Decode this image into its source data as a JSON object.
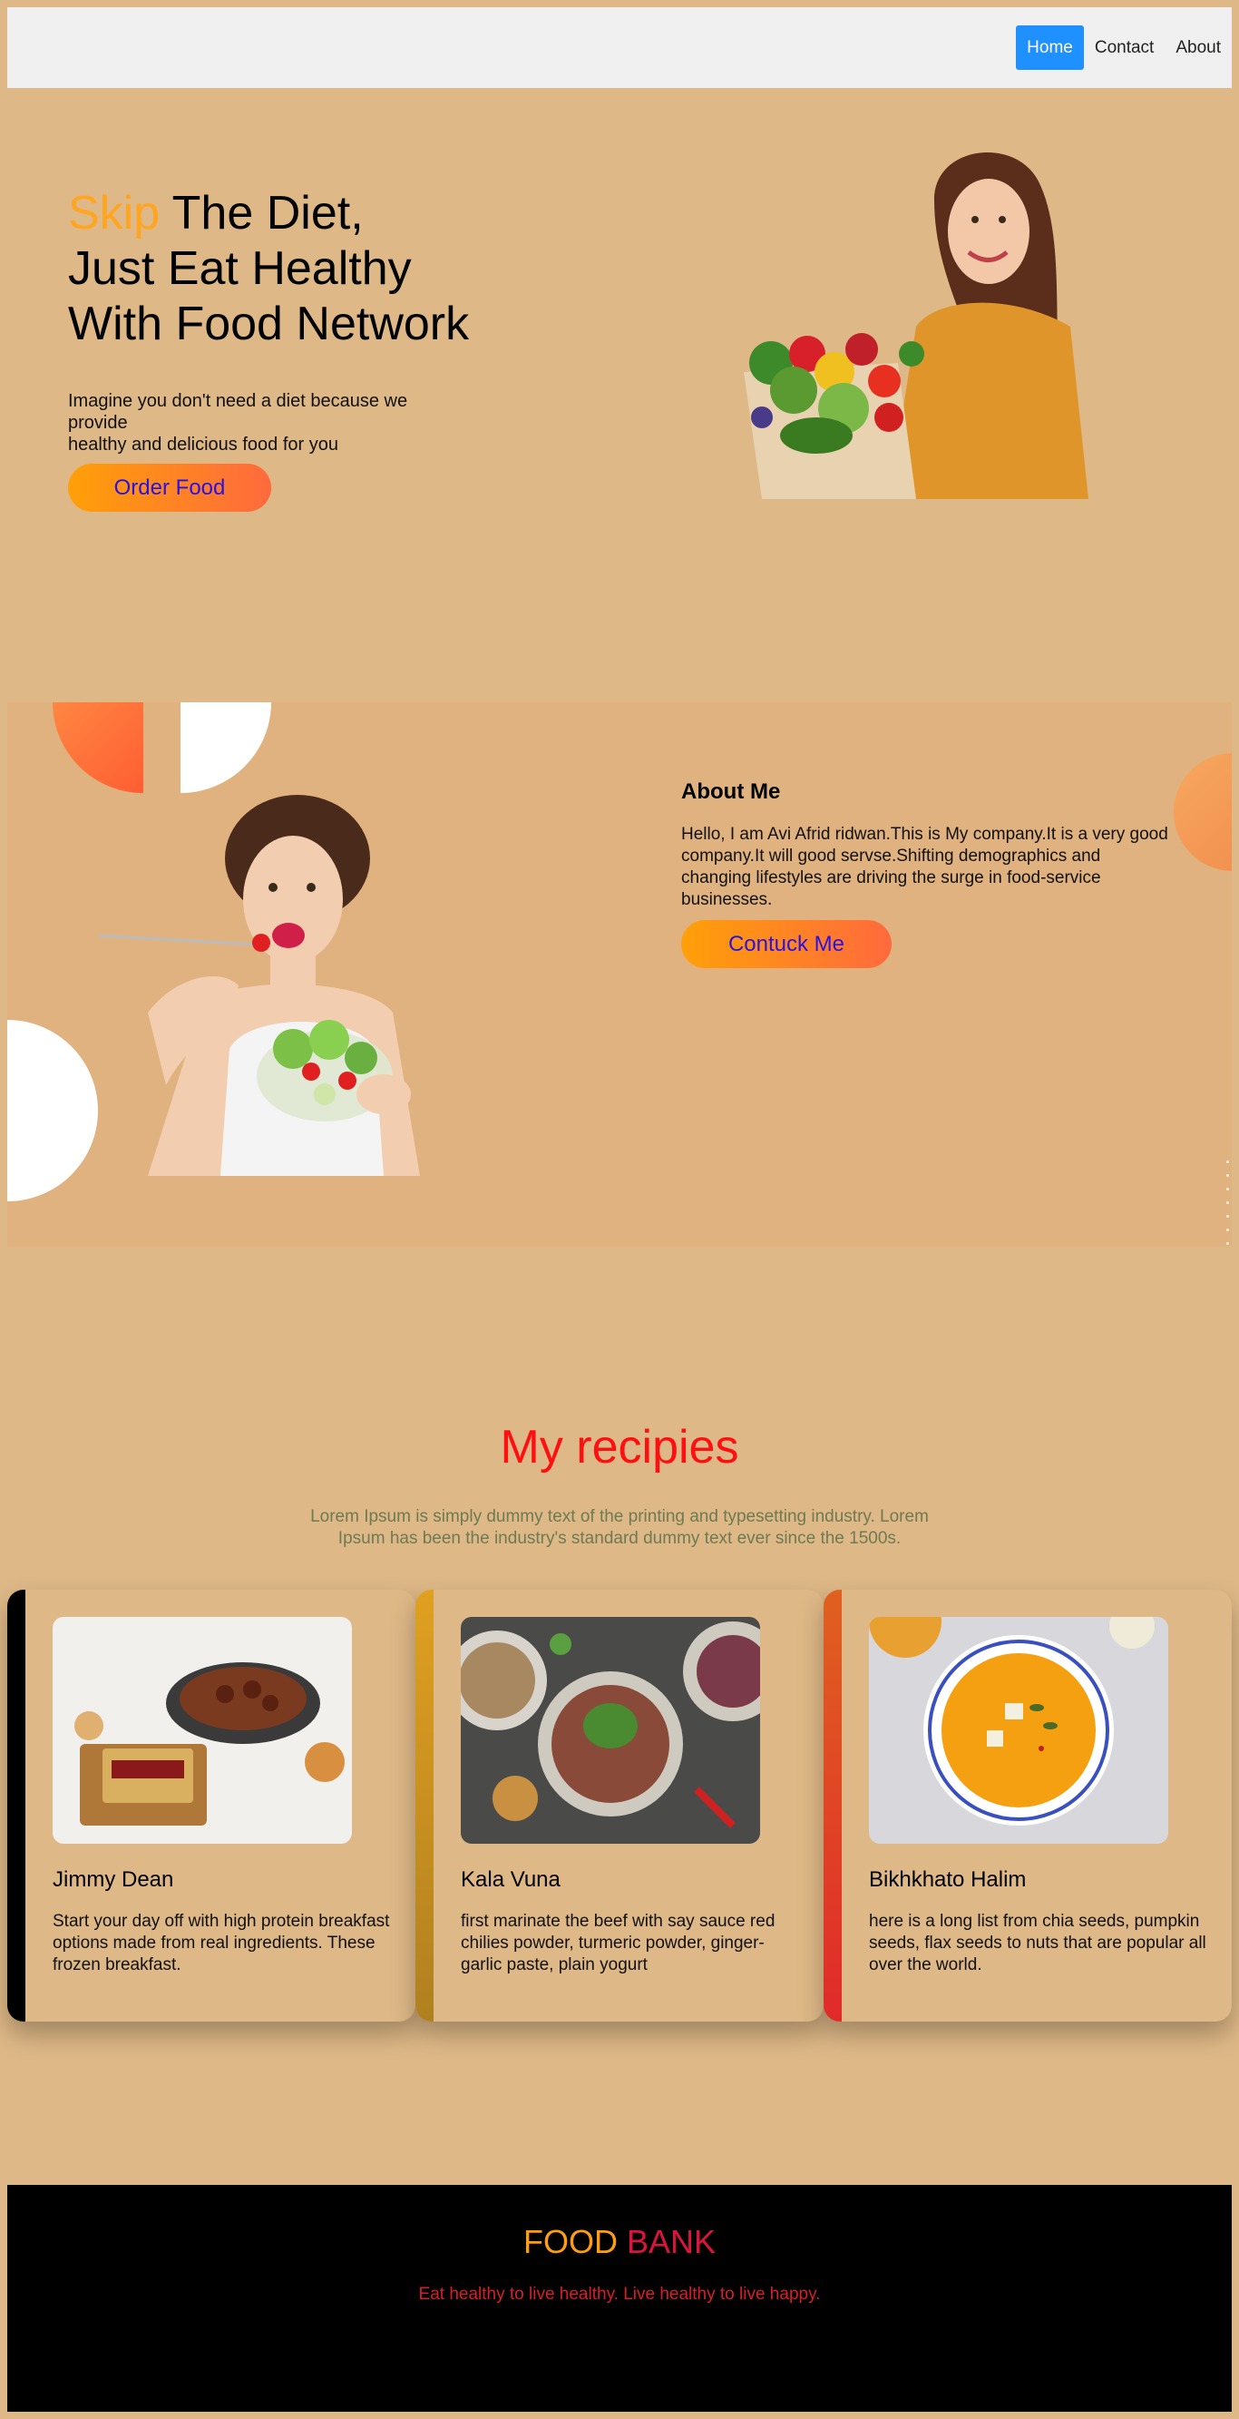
{
  "nav": {
    "items": [
      {
        "label": "Home",
        "active": true
      },
      {
        "label": "Contact",
        "active": false
      },
      {
        "label": "About",
        "active": false
      }
    ],
    "active_color": "#1e90ff"
  },
  "hero": {
    "title_accent": "Skip",
    "title_line1": " The Diet,",
    "title_line2": "Just Eat Healthy",
    "title_line3": "With Food Network",
    "desc_line1": "Imagine you don't need a diet because we provide",
    "desc_line2": "healthy and delicious food for you",
    "button": "Order Food"
  },
  "about": {
    "heading": "About Me",
    "text": "Hello, I am Avi Afrid ridwan.This is My company.It is a very good company.It will good servse.Shifting demographics and changing lifestyles are driving the surge in food-service businesses.",
    "button": "Contuck Me"
  },
  "recipes": {
    "title": "My recipies",
    "subtitle": "Lorem Ipsum is simply dummy text of the printing and typesetting industry. Lorem Ipsum has been the industry's standard dummy text ever since the 1500s.",
    "cards": [
      {
        "title": "Jimmy Dean",
        "text": "Start your day off with high protein breakfast options made from real ingredients. These frozen breakfast.",
        "bar_color": "#000000"
      },
      {
        "title": "Kala Vuna",
        "text": "first marinate the beef with say sauce red chilies powder, turmeric powder, ginger-garlic paste, plain yogurt",
        "bar_color": "#d8a020"
      },
      {
        "title": "Bikhkhato Halim",
        "text": "here is a long list from chia seeds, pumpkin seeds, flax seeds to nuts that are popular all over the world.",
        "bar_color": "#e02a2a"
      }
    ]
  },
  "footer": {
    "brand_part1": "FOOD",
    "brand_part2": "BANK",
    "tagline": "Eat healthy to live healthy. Live healthy to live happy."
  }
}
